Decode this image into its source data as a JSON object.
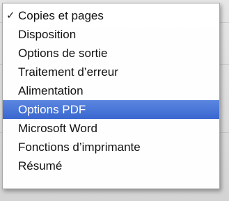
{
  "menu": {
    "check_glyph": "✓",
    "highlight_color": "#3f6dd6",
    "items": [
      {
        "label": "Copies et pages",
        "checked": true
      },
      {
        "label": "Disposition"
      },
      {
        "label": "Options de sortie"
      },
      {
        "label": "Traitement d’erreur"
      },
      {
        "label": "Alimentation"
      },
      {
        "label": "Options PDF",
        "highlighted": true
      },
      {
        "label": "Microsoft Word"
      },
      {
        "label": "Fonctions d’imprimante"
      },
      {
        "label": "Résumé"
      }
    ]
  }
}
